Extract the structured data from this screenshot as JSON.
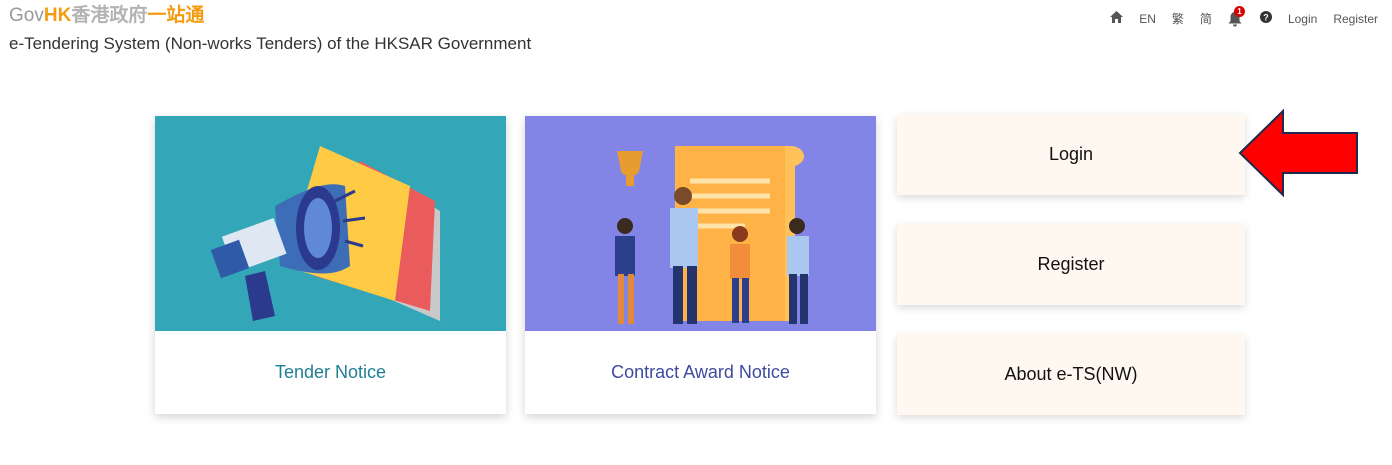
{
  "header": {
    "logo_gov": "Gov",
    "logo_hk": "HK",
    "logo_cn": "香港政府",
    "logo_cn2": "一站通",
    "subtitle": "e-Tendering System (Non-works Tenders) of the HKSAR Government"
  },
  "topnav": {
    "lang_en": "EN",
    "lang_tc": "繁",
    "lang_sc": "简",
    "notification_count": "1",
    "login": "Login",
    "register": "Register",
    "icons": [
      "home-icon",
      "bell-icon",
      "help-icon"
    ]
  },
  "cards": [
    {
      "label": "Tender Notice",
      "color": "#33a6b8"
    },
    {
      "label": "Contract Award Notice",
      "color": "#8385e6"
    }
  ],
  "buttons": {
    "login": "Login",
    "register": "Register",
    "about": "About e-TS(NW)"
  },
  "colors": {
    "accent": "#f39c12",
    "arrow": "#e00000",
    "button_bg": "#fff8f0"
  }
}
